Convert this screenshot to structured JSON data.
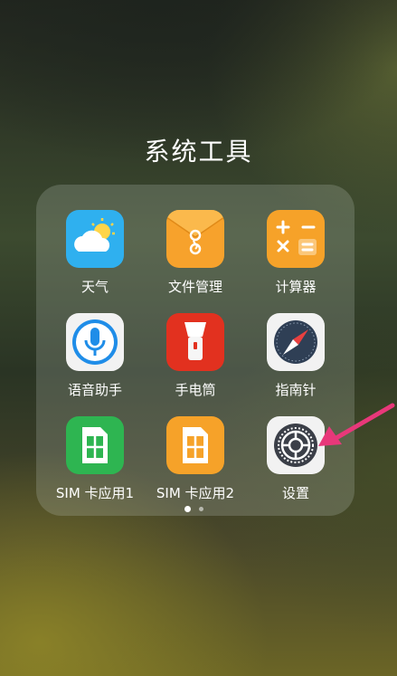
{
  "folder": {
    "title": "系统工具",
    "apps": [
      {
        "label": "天气",
        "icon": "weather-icon",
        "color": "#2fb0ef"
      },
      {
        "label": "文件管理",
        "icon": "file-manager-icon",
        "color": "#f7a22c"
      },
      {
        "label": "计算器",
        "icon": "calculator-icon",
        "color": "#f6a229"
      },
      {
        "label": "语音助手",
        "icon": "voice-assistant-icon",
        "color": "#f2f2f2"
      },
      {
        "label": "手电筒",
        "icon": "flashlight-icon",
        "color": "#e2311f"
      },
      {
        "label": "指南针",
        "icon": "compass-icon",
        "color": "#f2f2f2"
      },
      {
        "label": "SIM 卡应用1",
        "icon": "sim-card-1-icon",
        "color": "#2eb551"
      },
      {
        "label": "SIM 卡应用2",
        "icon": "sim-card-2-icon",
        "color": "#f6a229"
      },
      {
        "label": "设置",
        "icon": "settings-icon",
        "color": "#f2f2f2"
      }
    ]
  },
  "pagination": {
    "pages": 2,
    "current": 1
  },
  "annotation": {
    "icon": "arrow-icon",
    "color": "#e8387a"
  }
}
